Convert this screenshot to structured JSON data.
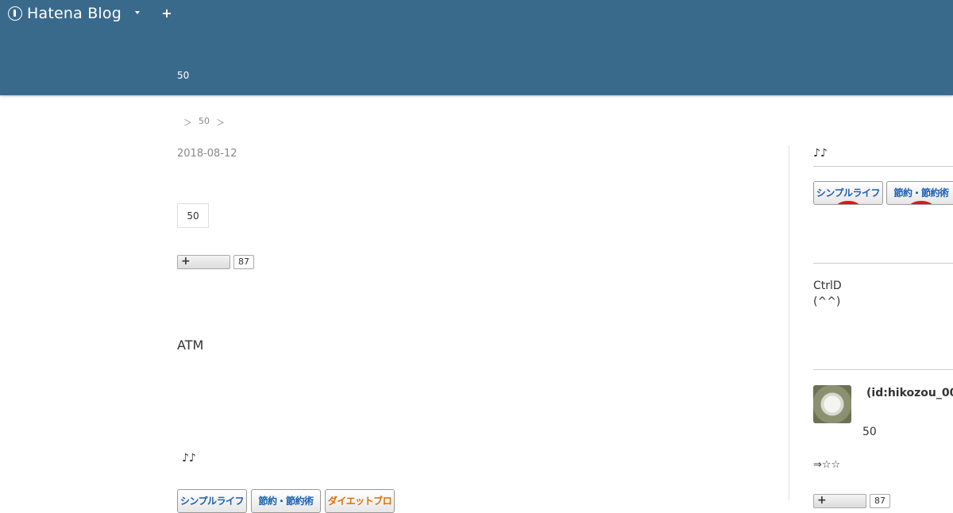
{
  "header": {
    "logo_text": "Hatena Blog",
    "blog_title": "50",
    "background": "#3a6a8b"
  },
  "breadcrumb": [
    "＞",
    "50",
    "＞"
  ],
  "entry": {
    "date": "2018-08-12",
    "category": "50",
    "bookmark_count": "87",
    "atm_text": "ATM",
    "music_text": "♪♪",
    "banners": [
      "シンプルライフ",
      "節約・節約術",
      "ダイエットブログ"
    ]
  },
  "sidebar": {
    "music_text": "♪♪",
    "banners": [
      "シンプルライフ",
      "節約・節約術"
    ],
    "about_line1": "CtrlD",
    "about_line2": "(^^)",
    "profile_id": "(id:hikozou_00",
    "profile_number": "50",
    "stars": "⇒☆☆",
    "bookmark_count": "87"
  }
}
